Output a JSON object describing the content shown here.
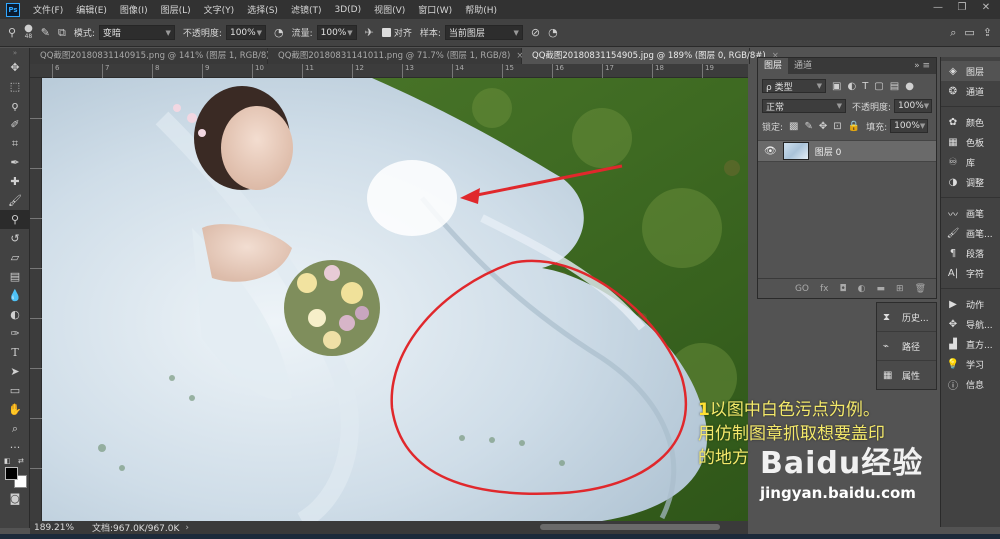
{
  "app": {
    "logo": "Ps"
  },
  "menu": [
    "文件(F)",
    "编辑(E)",
    "图像(I)",
    "图层(L)",
    "文字(Y)",
    "选择(S)",
    "滤镜(T)",
    "3D(D)",
    "视图(V)",
    "窗口(W)",
    "帮助(H)"
  ],
  "window_controls": {
    "minimize": "—",
    "restore": "❐",
    "close": "✕"
  },
  "options": {
    "brush_size": "48",
    "mode_label": "模式:",
    "mode_value": "变暗",
    "opacity_label": "不透明度:",
    "opacity_value": "100%",
    "flow_label": "流量:",
    "flow_value": "100%",
    "aligned_label": "对齐",
    "sample_label": "样本:",
    "sample_value": "当前图层"
  },
  "tabs": [
    {
      "label": "QQ截图20180831140915.png @ 141% (图层 1, RGB/8)",
      "close": "×",
      "active": false
    },
    {
      "label": "QQ截图20180831141011.png @ 71.7% (图层 1, RGB/8)",
      "close": "×",
      "active": false
    },
    {
      "label": "QQ截图20180831154905.jpg @ 189% (图层 0, RGB/8#)",
      "close": "×",
      "active": true
    }
  ],
  "ruler": [
    "6",
    "7",
    "8",
    "9",
    "10",
    "11",
    "12",
    "13",
    "14",
    "15",
    "16",
    "17",
    "18",
    "19"
  ],
  "status": {
    "zoom": "189.21%",
    "doc": "文档:967.0K/967.0K"
  },
  "layers_panel": {
    "tab_layers": "图层",
    "tab_channels": "通道",
    "filter_label": "ρ 类型",
    "blend_mode": "正常",
    "opacity_label": "不透明度:",
    "opacity_value": "100%",
    "lock_label": "锁定:",
    "fill_label": "填充:",
    "fill_value": "100%",
    "layer_name": "图层 0",
    "footer_icons": [
      "GO",
      "fx",
      "◘",
      "◐",
      "▬",
      "⊞",
      "🗑"
    ]
  },
  "mini_panel": [
    {
      "label": "历史...",
      "icon": "history-icon"
    },
    {
      "label": "路径",
      "icon": "paths-icon"
    },
    {
      "label": "属性",
      "icon": "properties-icon"
    }
  ],
  "right_dock": {
    "group1": [
      "图层",
      "通道"
    ],
    "group2": [
      "颜色",
      "色板",
      "库",
      "调整"
    ],
    "group3": [
      "画笔",
      "画笔...",
      "段落",
      "字符"
    ],
    "group4": [
      "动作",
      "导航...",
      "直方...",
      "学习",
      "信息"
    ]
  },
  "annotation": {
    "number": "1",
    "line1": "以图中白色污点为例。",
    "line2": "用仿制图章抓取想要盖印",
    "line3": "的地方"
  },
  "watermark": {
    "brand": "Baidu经验",
    "url": "jingyan.baidu.com"
  },
  "colors": {
    "accent": "#31a8ff",
    "annotation_circle": "#e0282c",
    "annotation_text": "#f4e96a"
  }
}
